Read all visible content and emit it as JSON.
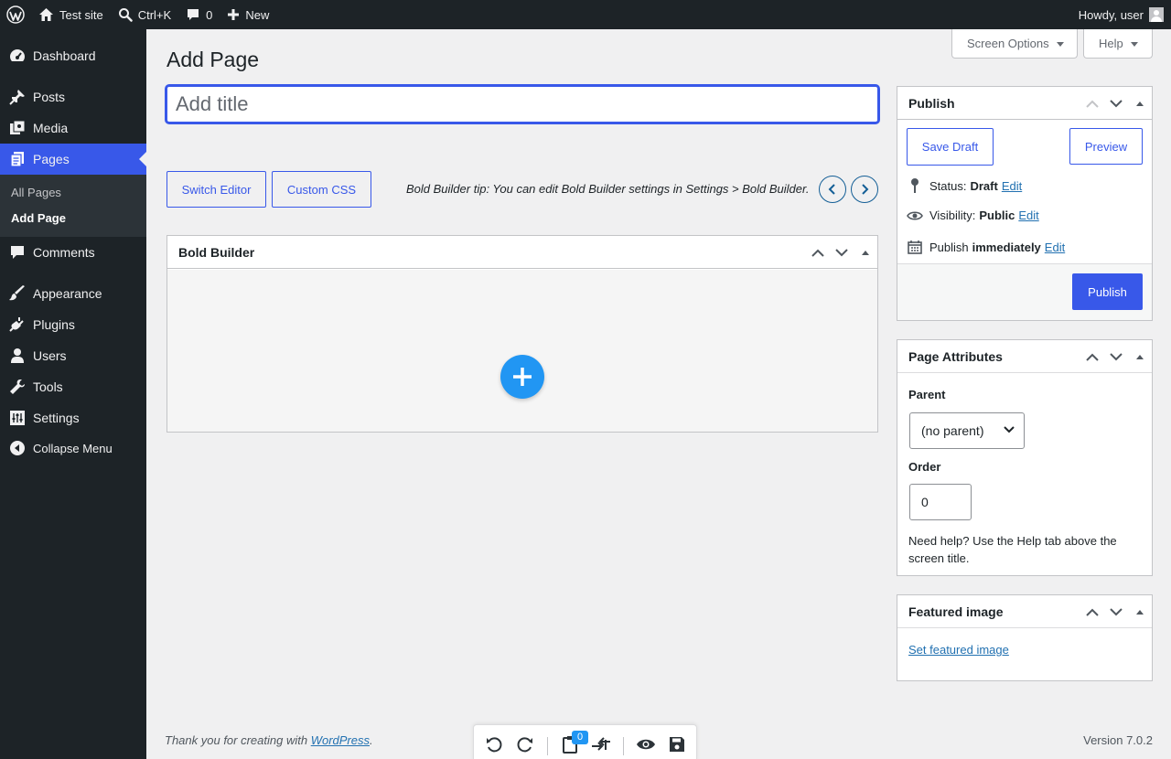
{
  "admin_bar": {
    "site_name": "Test site",
    "search_shortcut": "Ctrl+K",
    "comments_count": "0",
    "new_label": "New",
    "howdy": "Howdy, user"
  },
  "sidebar": {
    "items": [
      {
        "label": "Dashboard",
        "icon": "dashboard-icon"
      },
      {
        "label": "Posts",
        "icon": "pushpin-icon"
      },
      {
        "label": "Media",
        "icon": "media-icon"
      },
      {
        "label": "Pages",
        "icon": "pages-icon",
        "current": true
      },
      {
        "label": "Comments",
        "icon": "comment-icon"
      },
      {
        "label": "Appearance",
        "icon": "brush-icon"
      },
      {
        "label": "Plugins",
        "icon": "plugin-icon"
      },
      {
        "label": "Users",
        "icon": "user-icon"
      },
      {
        "label": "Tools",
        "icon": "wrench-icon"
      },
      {
        "label": "Settings",
        "icon": "settings-icon"
      }
    ],
    "submenu": [
      {
        "label": "All Pages"
      },
      {
        "label": "Add Page",
        "active": true
      }
    ],
    "collapse_label": "Collapse Menu"
  },
  "screen_options": {
    "screen_label": "Screen Options",
    "help_label": "Help"
  },
  "page_title": "Add Page",
  "title_input": {
    "placeholder": "Add title",
    "value": ""
  },
  "editor": {
    "switch_editor": "Switch Editor",
    "custom_css": "Custom CSS",
    "tip": "Bold Builder tip: You can edit Bold Builder settings in Settings > Bold Builder."
  },
  "bold_builder": {
    "title": "Bold Builder"
  },
  "publish_box": {
    "title": "Publish",
    "save_draft": "Save Draft",
    "preview": "Preview",
    "status_label": "Status:",
    "status_value": "Draft",
    "visibility_label": "Visibility:",
    "visibility_value": "Public",
    "publish_label": "Publish",
    "publish_value": "immediately",
    "edit_link": "Edit",
    "publish_button": "Publish"
  },
  "page_attributes": {
    "title": "Page Attributes",
    "parent_label": "Parent",
    "parent_value": "(no parent)",
    "order_label": "Order",
    "order_value": "0",
    "help_text": "Need help? Use the Help tab above the screen title."
  },
  "featured_image": {
    "title": "Featured image",
    "link": "Set featured image"
  },
  "footer": {
    "thanks_prefix": "Thank you for creating with ",
    "thanks_link": "WordPress",
    "thanks_suffix": ".",
    "version": "Version 7.0.2"
  },
  "toolbar": {
    "clipboard_count": "0"
  },
  "colors": {
    "accent": "#3858e9",
    "admin_dark": "#1d2327",
    "builder_blue": "#2196f3",
    "link": "#2271b1"
  }
}
